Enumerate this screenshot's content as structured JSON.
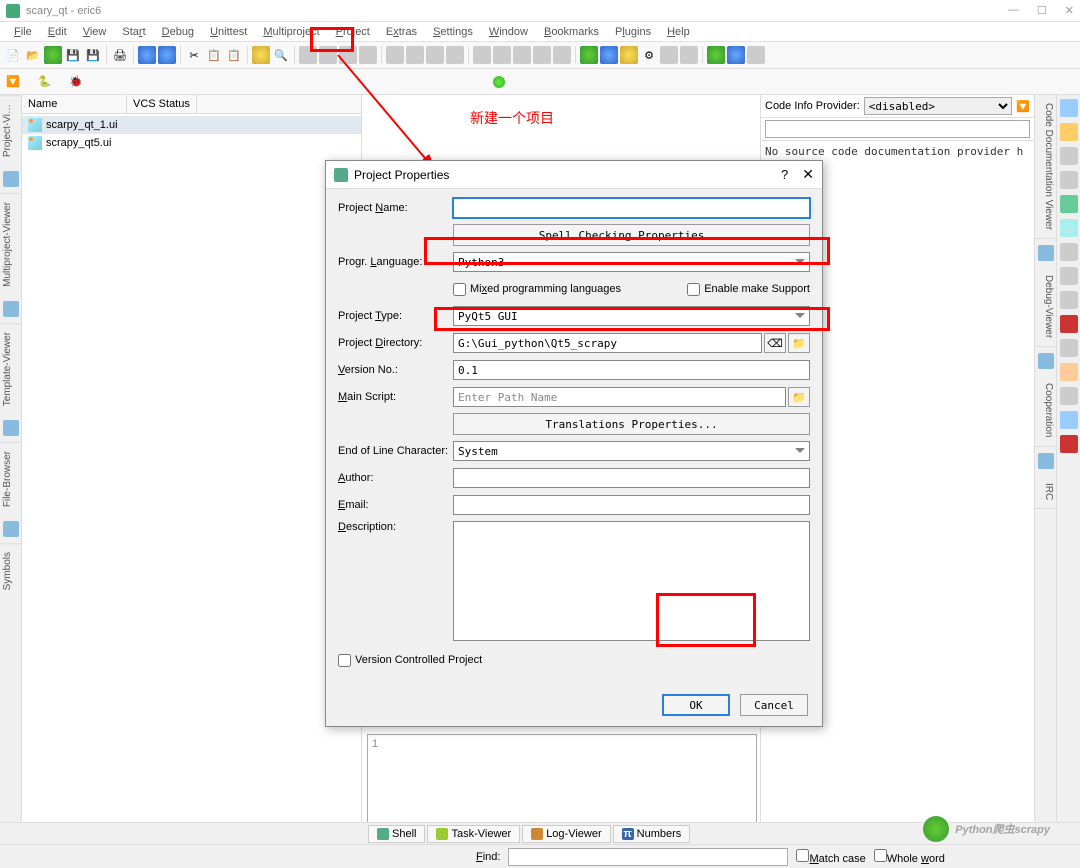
{
  "window": {
    "title": "scary_qt - eric6"
  },
  "menubar": [
    "File",
    "Edit",
    "View",
    "Start",
    "Debug",
    "Unittest",
    "Multiproject",
    "Project",
    "Extras",
    "Settings",
    "Window",
    "Bookmarks",
    "Plugins",
    "Help"
  ],
  "project_viewer": {
    "columns": [
      "Name",
      "VCS Status"
    ],
    "files": [
      "scarpy_qt_1.ui",
      "scrapy_qt5.ui"
    ]
  },
  "info_panel": {
    "label": "Code Info Provider:",
    "selected": "<disabled>",
    "body": "No source code documentation provider h"
  },
  "annotation": "新建一个项目",
  "dialog": {
    "title": "Project Properties",
    "fields": {
      "project_name_label": "Project Name:",
      "project_name": "",
      "spell_btn": "Spell Checking Properties...",
      "lang_label": "Progr. Language:",
      "lang": "Python3",
      "mixed_label": "Mixed programming languages",
      "make_label": "Enable  make  Support",
      "type_label": "Project Type:",
      "type": "PyQt5 GUI",
      "dir_label": "Project Directory:",
      "dir": "G:\\Gui_python\\Qt5_scrapy",
      "ver_label": "Version No.:",
      "ver": "0.1",
      "main_label": "Main Script:",
      "main_placeholder": "Enter Path Name",
      "trans_btn": "Translations Properties...",
      "eol_label": "End of Line Character:",
      "eol": "System",
      "author_label": "Author:",
      "email_label": "Email:",
      "descr_label": "Description:",
      "vcs_label": "Version Controlled Project",
      "ok": "OK",
      "cancel": "Cancel"
    }
  },
  "left_tabs": [
    "Project-Vi…",
    "Multiproject-Viewer",
    "Template-Viewer",
    "File-Browser",
    "Symbols"
  ],
  "right_tabs": [
    "Code Documentation Viewer",
    "Debug-Viewer",
    "Cooperation",
    "IRC"
  ],
  "bottom_tabs": [
    "Shell",
    "Task-Viewer",
    "Log-Viewer",
    "Numbers"
  ],
  "editor2_content": "1",
  "find": {
    "label": "Find:",
    "match_case": "Match case",
    "whole_word": "Whole word"
  },
  "watermark": "Python爬虫scrapy"
}
